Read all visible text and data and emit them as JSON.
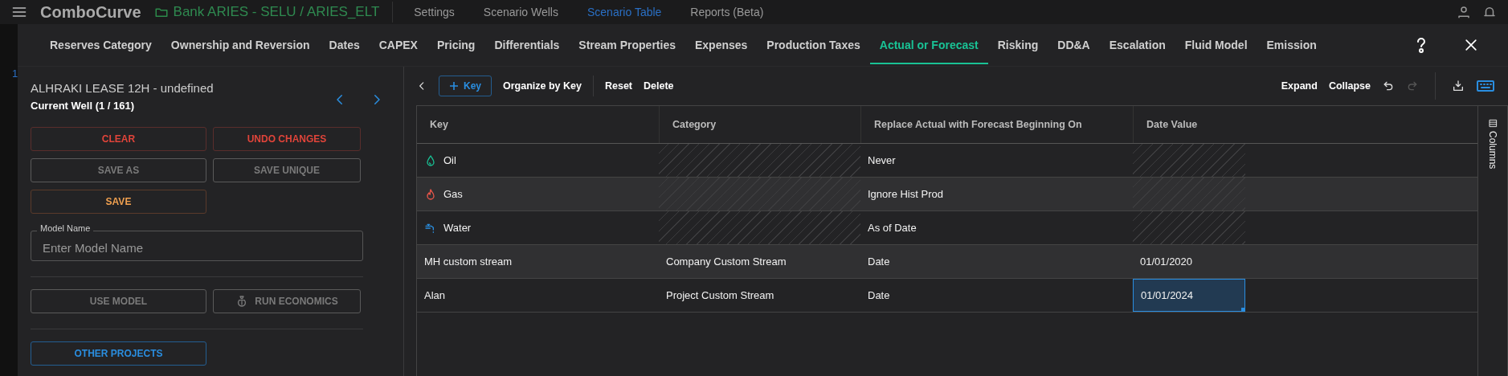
{
  "app_header": {
    "logo": "ComboCurve",
    "project_path": "Bank ARIES - SELU  /  ARIES_ELT",
    "nav": [
      {
        "label": "Settings",
        "selected": false
      },
      {
        "label": "Scenario Wells",
        "selected": false
      },
      {
        "label": "Scenario Table",
        "selected": true
      },
      {
        "label": "Reports (Beta)",
        "selected": false
      }
    ]
  },
  "background_table": {
    "row_number": "1"
  },
  "dialog": {
    "tabs": [
      {
        "label": "Reserves Category",
        "selected": false
      },
      {
        "label": "Ownership and Reversion",
        "selected": false
      },
      {
        "label": "Dates",
        "selected": false
      },
      {
        "label": "CAPEX",
        "selected": false
      },
      {
        "label": "Pricing",
        "selected": false
      },
      {
        "label": "Differentials",
        "selected": false
      },
      {
        "label": "Stream Properties",
        "selected": false
      },
      {
        "label": "Expenses",
        "selected": false
      },
      {
        "label": "Production Taxes",
        "selected": false
      },
      {
        "label": "Actual or Forecast",
        "selected": true
      },
      {
        "label": "Risking",
        "selected": false
      },
      {
        "label": "DD&A",
        "selected": false
      },
      {
        "label": "Escalation",
        "selected": false
      },
      {
        "label": "Fluid Model",
        "selected": false
      },
      {
        "label": "Emission",
        "selected": false
      }
    ]
  },
  "left_panel": {
    "well_title": "ALHRAKI LEASE 12H - undefined",
    "well_counter": "Current Well (1 / 161)",
    "action_buttons": [
      {
        "label": "CLEAR",
        "kind": "danger",
        "disabled": false
      },
      {
        "label": "UNDO CHANGES",
        "kind": "danger",
        "disabled": false
      },
      {
        "label": "SAVE AS",
        "kind": "plain",
        "disabled": true
      },
      {
        "label": "SAVE UNIQUE",
        "kind": "plain",
        "disabled": true
      },
      {
        "label": "SAVE",
        "kind": "warning",
        "disabled": false
      }
    ],
    "model_name": {
      "label": "Model Name",
      "placeholder": "Enter Model Name"
    },
    "run_buttons": [
      {
        "label": "USE MODEL",
        "kind": "plain",
        "disabled": true
      },
      {
        "label": "RUN ECONOMICS",
        "kind": "economics",
        "disabled": true
      }
    ],
    "project_buttons": [
      {
        "label": "OTHER PROJECTS",
        "kind": "primary",
        "disabled": false
      }
    ]
  },
  "toolbar": {
    "add_button": "Key",
    "left_actions": [
      "Organize by Key",
      "Reset",
      "Delete"
    ],
    "right_actions": [
      "Expand",
      "Collapse"
    ],
    "icons": [
      {
        "kind": "undo",
        "disabled": false
      },
      {
        "kind": "redo",
        "disabled": true
      },
      {
        "kind": "download",
        "disabled": false
      },
      {
        "kind": "keyboard",
        "disabled": false
      }
    ]
  },
  "table": {
    "columns": [
      "Key",
      "Category",
      "Replace Actual with Forecast Beginning On",
      "Date Value"
    ],
    "rows": [
      {
        "kind": "oil",
        "cells": [
          {
            "text": "Oil",
            "disabled": false,
            "selected": false
          },
          {
            "disabled": true,
            "selected": false
          },
          {
            "text": "Never",
            "disabled": false,
            "selected": false
          },
          {
            "disabled": true,
            "selected": false
          }
        ]
      },
      {
        "kind": "gas",
        "cells": [
          {
            "text": "Gas",
            "disabled": false,
            "selected": false
          },
          {
            "disabled": true,
            "selected": false
          },
          {
            "text": "Ignore Hist Prod",
            "disabled": false,
            "selected": false
          },
          {
            "disabled": true,
            "selected": false
          }
        ]
      },
      {
        "kind": "water",
        "cells": [
          {
            "text": "Water",
            "disabled": false,
            "selected": false
          },
          {
            "disabled": true,
            "selected": false
          },
          {
            "text": "As of Date",
            "disabled": false,
            "selected": false
          },
          {
            "disabled": true,
            "selected": false
          }
        ]
      },
      {
        "kind": "custom",
        "cells": [
          {
            "text": "MH custom stream",
            "disabled": false,
            "selected": false
          },
          {
            "text": "Company Custom Stream",
            "disabled": false,
            "selected": false
          },
          {
            "text": "Date",
            "disabled": false,
            "selected": false
          },
          {
            "text": "01/01/2020",
            "disabled": false,
            "selected": false
          }
        ]
      },
      {
        "kind": "custom",
        "cells": [
          {
            "text": "Alan",
            "disabled": false,
            "selected": false
          },
          {
            "text": "Project Custom Stream",
            "disabled": false,
            "selected": false
          },
          {
            "text": "Date",
            "disabled": false,
            "selected": false
          },
          {
            "text": "01/01/2024",
            "disabled": false,
            "selected": true
          }
        ]
      }
    ],
    "side_panel": "Columns"
  }
}
